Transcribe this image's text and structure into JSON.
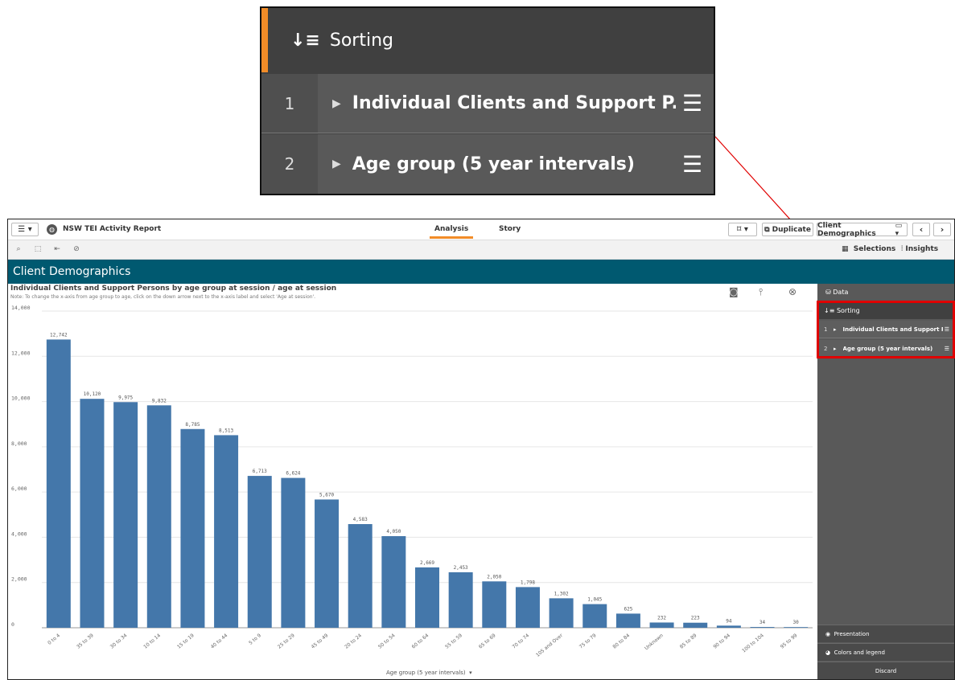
{
  "callout": {
    "icon": "sort-icon",
    "title": "Sorting",
    "items": [
      {
        "number": "1",
        "label": "Individual Clients and Support P..."
      },
      {
        "number": "2",
        "label": "Age group (5 year intervals)"
      }
    ]
  },
  "app": {
    "app_title": "NSW TEI Activity Report",
    "tabs": [
      {
        "label": "Analysis",
        "active": true
      },
      {
        "label": "Story",
        "active": false
      }
    ],
    "duplicate_label": "Duplicate",
    "sheet_selector": "Client Demographics",
    "selections_label": "Selections",
    "insights_label": "Insights",
    "sheet_title": "Client Demographics"
  },
  "chart": {
    "title": "Individual Clients and Support Persons by age group at session / age at session",
    "note": "Note: To change the x-axis from age group to age, click on the down arrow next to the x-axis label and select 'Age at session'.",
    "xlabel": "Age group (5 year intervals)"
  },
  "panel": {
    "data_label": "Data",
    "sorting_label": "Sorting",
    "items": [
      {
        "number": "1",
        "label": "Individual Clients and Support P..."
      },
      {
        "number": "2",
        "label": "Age group (5 year intervals)"
      }
    ],
    "presentation_label": "Presentation",
    "colors_label": "Colors and legend",
    "discard_label": "Discard"
  },
  "colors": {
    "bar": "#4477aa",
    "sheet_bar": "#005970",
    "accent": "#f28c28",
    "highlight": "#e00000"
  },
  "chart_data": {
    "type": "bar",
    "title": "Individual Clients and Support Persons by age group at session / age at session",
    "xlabel": "Age group (5 year intervals)",
    "ylabel": "",
    "ylim": [
      0,
      14000
    ],
    "yticks": [
      "0",
      "2,000",
      "4,000",
      "6,000",
      "8,000",
      "10,000",
      "12,000",
      "14,000"
    ],
    "grid": true,
    "categories": [
      "0 to 4",
      "35 to 39",
      "30 to 34",
      "10 to 14",
      "15 to 19",
      "40 to 44",
      "5 to 9",
      "25 to 29",
      "45 to 49",
      "20 to 24",
      "50 to 54",
      "60 to 64",
      "55 to 59",
      "65 to 69",
      "70 to 74",
      "105 and Over",
      "75 to 79",
      "80 to 84",
      "Unknown",
      "85 to 89",
      "90 to 94",
      "100 to 104",
      "95 to 99"
    ],
    "values": [
      12742,
      10120,
      9975,
      9832,
      8785,
      8513,
      6713,
      6624,
      5670,
      4583,
      4050,
      2669,
      2453,
      2050,
      1798,
      1302,
      1045,
      625,
      232,
      223,
      94,
      34,
      30
    ],
    "labels": [
      "12,742",
      "10,120",
      "9,975",
      "9,832",
      "8,785",
      "8,513",
      "6,713",
      "6,624",
      "5,670",
      "4,583",
      "4,050",
      "2,669",
      "2,453",
      "2,050",
      "1,798",
      "1,302",
      "1,045",
      "625",
      "232",
      "223",
      "94",
      "34",
      "30"
    ]
  }
}
